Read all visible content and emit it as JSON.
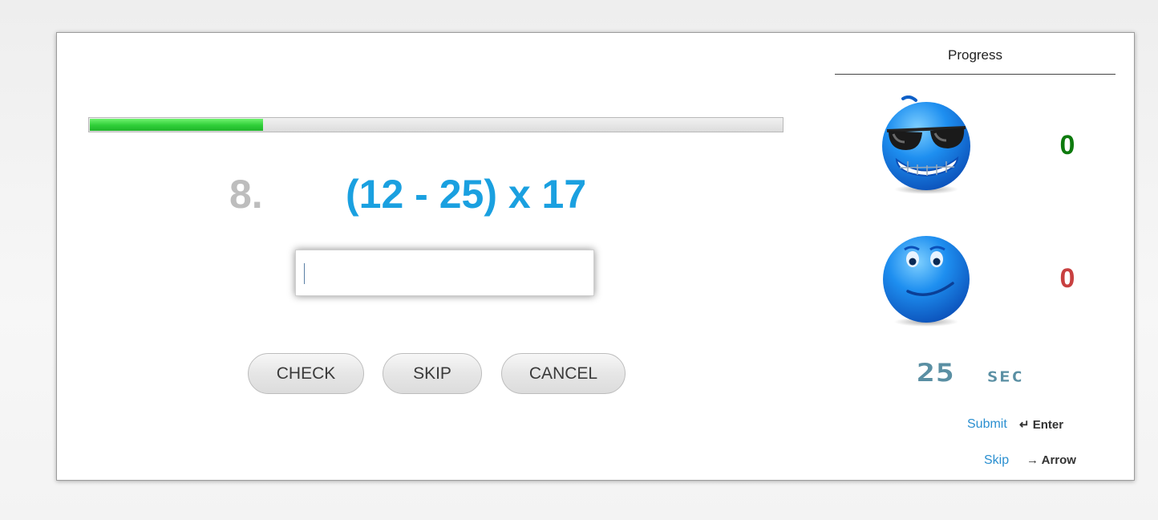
{
  "quiz": {
    "progress_percent": 25,
    "question_number": "8.",
    "question": "(12 - 25) x 17",
    "answer_value": "",
    "buttons": {
      "check": "CHECK",
      "skip": "SKIP",
      "cancel": "CANCEL"
    }
  },
  "sidebar": {
    "title": "Progress",
    "correct_icon": "cool-sunglasses-emoji-icon",
    "correct_count": "0",
    "wrong_icon": "smiling-emoji-icon",
    "wrong_count": "0",
    "timer_value": "25",
    "timer_unit": "SEC",
    "hints": {
      "submit_label": "Submit",
      "submit_key": "↵ Enter",
      "skip_label": "Skip",
      "skip_key": "→ Arrow"
    }
  },
  "colors": {
    "accent_blue": "#1aa0e0",
    "correct_green": "#0d7a0d",
    "wrong_red": "#c84040",
    "progress_green": "#2fcf38",
    "timer_teal": "#5a8fa3"
  }
}
